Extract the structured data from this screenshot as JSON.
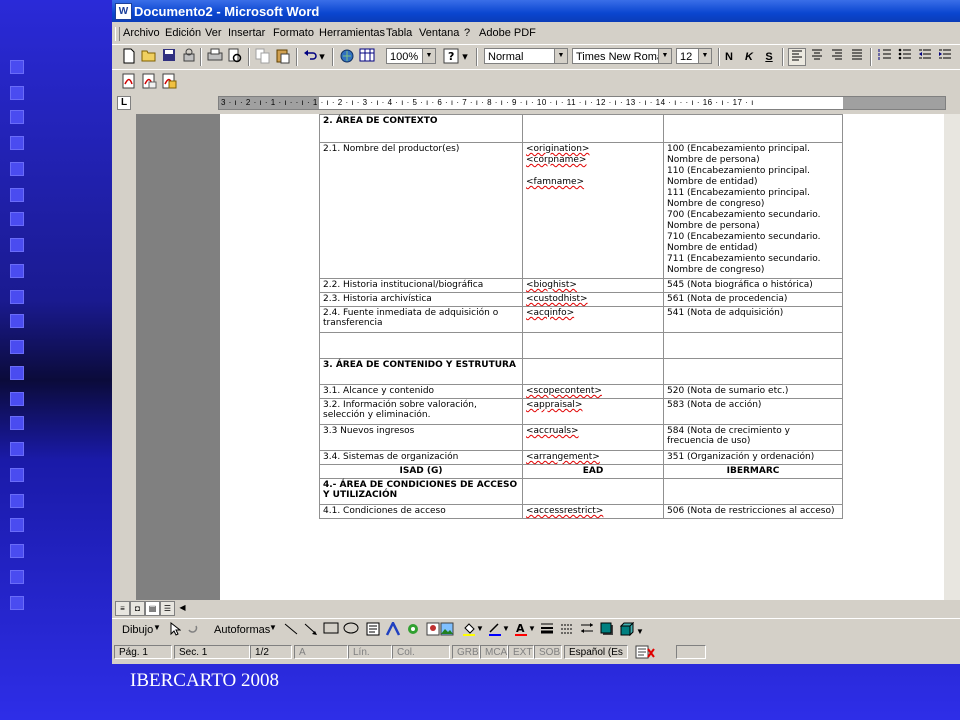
{
  "slide": {
    "footer": "IBERCARTO 2008"
  },
  "window": {
    "app_icon": "W",
    "title": "Documento2 - Microsoft Word"
  },
  "menubar": [
    "Archivo",
    "Edición",
    "Ver",
    "Insertar",
    "Formato",
    "Herramientas",
    "Tabla",
    "Ventana",
    "?",
    "Adobe PDF"
  ],
  "toolbar": {
    "zoom": "100%",
    "style": "Normal",
    "font": "Times New Roman",
    "size": "12",
    "bold_label": "N",
    "italic_label": "K",
    "underline_label": "S"
  },
  "ruler": {
    "labels": "3 · ı · 2 · ı · 1 · ı ·   · ı · 1 · ı · 2 · ı · 3 · ı · 4 · ı · 5 · ı · 6 · ı · 7 · ı · 8 · ı · 9 · ı · 10 · ı · 11 · ı · 12 · ı · 13 · ı · 14 · ı ·   · ı · 16 · ı · 17 · ı"
  },
  "table": {
    "rows": [
      {
        "c1": "2. ÁREA DE CONTEXTO",
        "c1_bold": true,
        "c2": "",
        "c3": ""
      },
      {
        "c1": "2.1. Nombre del productor(es)",
        "c2_lines": [
          "<origination>",
          "<corpname>",
          "",
          "<famname>"
        ],
        "c3_lines": [
          "100 (Encabezamiento principal.",
          "Nombre de persona)",
          "110 (Encabezamiento principal.",
          "Nombre de entidad)",
          "111 (Encabezamiento principal.",
          "Nombre de congreso)",
          "700 (Encabezamiento secundario.",
          "Nombre de persona)",
          "710 (Encabezamiento secundario.",
          "Nombre de entidad)",
          "711 (Encabezamiento secundario.",
          "Nombre de congreso)"
        ]
      },
      {
        "c1": "2.2. Historia institucional/biográfica",
        "c2": "<bioghist>",
        "c3": "545 (Nota biográfica o histórica)"
      },
      {
        "c1": "2.3. Historia archivística",
        "c2": "<custodhist>",
        "c3": "561 (Nota de procedencia)"
      },
      {
        "c1": "2.4. Fuente inmediata de adquisición o transferencia",
        "c2": "<acqinfo>",
        "c3": "541 (Nota de adquisición)"
      },
      {
        "c1": "",
        "c2": "",
        "c3": ""
      },
      {
        "c1": "3. ÁREA DE CONTENIDO Y ESTRUTURA",
        "c1_bold": true,
        "c2": "",
        "c3": ""
      },
      {
        "c1": "3.1. Alcance y contenido",
        "c2": "<scopecontent>",
        "c3": "520 (Nota de sumario etc.)"
      },
      {
        "c1": "3.2. Información sobre valoración, selección y eliminación.",
        "c2": "<appraisal>",
        "c3": "583 (Nota de acción)"
      },
      {
        "c1": "3.3 Nuevos ingresos",
        "c2": "<accruals>",
        "c3": "584 (Nota de crecimiento y frecuencia de uso)"
      },
      {
        "c1": "3.4. Sistemas de organización",
        "c2": "<arrangement>",
        "c3": "351 (Organización y ordenación)"
      },
      {
        "header": true,
        "c1": "ISAD (G)",
        "c2": "EAD",
        "c3": "IBERMARC"
      },
      {
        "c1": "4.- ÁREA DE CONDICIONES DE ACCESO Y UTILIZACIÓN",
        "c1_bold": true,
        "c2": "",
        "c3": ""
      },
      {
        "c1": "4.1. Condiciones de acceso",
        "c2": "<accessrestrict>",
        "c3": "506 (Nota de restricciones al acceso)"
      }
    ]
  },
  "drawbar": {
    "draw": "Dibujo",
    "autoshapes": "Autoformas"
  },
  "statusbar": {
    "page": "Pág.  1",
    "section": "Sec.  1",
    "pages": "1/2",
    "at": "A",
    "line": "Lín.",
    "col": "Col.",
    "grb": "GRB",
    "mca": "MCA",
    "ext": "EXT",
    "sob": "SOB",
    "lang": "Español (Es"
  }
}
